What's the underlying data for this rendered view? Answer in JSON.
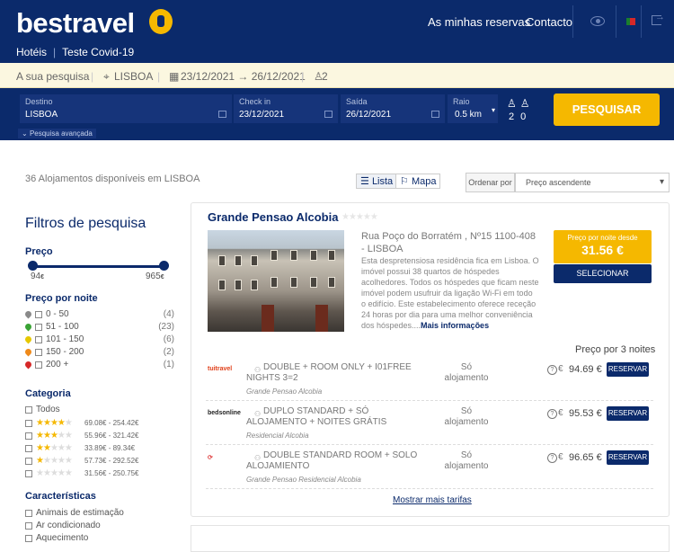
{
  "header": {
    "logo": "bestravel",
    "my_bookings": "As minhas reservas",
    "contact": "Contacto",
    "sub_links": [
      "Hotéis",
      "Teste Covid-19"
    ]
  },
  "summary": {
    "label": "A sua pesquisa",
    "city": "LISBOA",
    "dates": "23/12/2021 → 26/12/2021",
    "guests": "2"
  },
  "search": {
    "destino_label": "Destino",
    "destino_value": "LISBOA",
    "checkin_label": "Check in",
    "checkin_value": "23/12/2021",
    "saida_label": "Saída",
    "saida_value": "26/12/2021",
    "raio_label": "Raio",
    "raio_value": "0.5 km",
    "adults": "2",
    "children": "0",
    "button": "PESQUISAR",
    "advanced": "Pesquisa avançada"
  },
  "results": {
    "count_text": "36 Alojamentos disponíveis em LISBOA",
    "view_list": "Lista",
    "view_map": "Mapa",
    "sort_label": "Ordenar por",
    "sort_value": "Preço ascendente"
  },
  "filters": {
    "title": "Filtros de pesquisa",
    "price_title": "Preço",
    "price_min": "94",
    "price_max": "965",
    "currency": "€",
    "price_per_night_title": "Preço por noite",
    "price_ranges": [
      {
        "label": "0 - 50",
        "count": "(4)",
        "color": "#8a8a8a"
      },
      {
        "label": "51 - 100",
        "count": "(23)",
        "color": "#3aa335"
      },
      {
        "label": "101 - 150",
        "count": "(6)",
        "color": "#e6c800"
      },
      {
        "label": "150 - 200",
        "count": "(2)",
        "color": "#ef8a1a"
      },
      {
        "label": "200 +",
        "count": "(1)",
        "color": "#d62828"
      }
    ],
    "category_title": "Categoria",
    "category_all": "Todos",
    "categories": [
      {
        "stars": 4,
        "range": "69.08€ - 254.42€"
      },
      {
        "stars": 3,
        "range": "55.96€ - 321.42€"
      },
      {
        "stars": 2,
        "range": "33.89€ - 89.34€"
      },
      {
        "stars": 1,
        "range": "57.73€ - 292.52€"
      },
      {
        "stars": 0,
        "range": "31.56€ - 250.75€"
      }
    ],
    "features_title": "Características",
    "features": [
      "Animais de estimação",
      "Ar condicionado",
      "Aquecimento"
    ]
  },
  "hotel": {
    "name": "Grande Pensao Alcobia",
    "address": "Rua Poço do Borratém , Nº15 1100-408 - LISBOA",
    "description": "Esta despretensiosa residência fica em Lisboa. O imóvel possui 38 quartos de hóspedes acolhedores. Todos os hóspedes que ficam neste imóvel podem usufruir da ligação Wi-Fi em todo o edifício. Este estabelecimento oferece receção 24 horas por dia para uma melhor conveniência dos hóspedes....",
    "more_info": "Mais informações",
    "price_label": "Preço por noite desde",
    "price": "31.56 €",
    "select": "SELECIONAR",
    "price_3_nights": "Preço por 3 noites",
    "offers": [
      {
        "provider": "tuitravel",
        "provider_color": "#e0401a",
        "room": "DOUBLE + ROOM ONLY + I01FREE NIGHTS 3=2",
        "hotel": "Grande Pensao Alcobia",
        "board": "Só alojamento",
        "price": "94.69 €",
        "button": "RESERVAR"
      },
      {
        "provider": "bedsonline",
        "provider_color": "#222222",
        "room": "DUPLO STANDARD + SÓ ALOJAMENTO + NOITES GRÁTIS",
        "hotel": "Residencial Alcobia",
        "board": "Só alojamento",
        "price": "95.53 €",
        "button": "RESERVAR"
      },
      {
        "provider": "",
        "provider_color": "#e04040",
        "room": "DOUBLE STANDARD ROOM + SOLO ALOJAMIENTO",
        "hotel": "Grande Pensao Residencial Alcobia",
        "board": "Só alojamento",
        "price": "96.65 €",
        "button": "RESERVAR"
      }
    ],
    "show_more": "Mostrar mais tarifas"
  }
}
